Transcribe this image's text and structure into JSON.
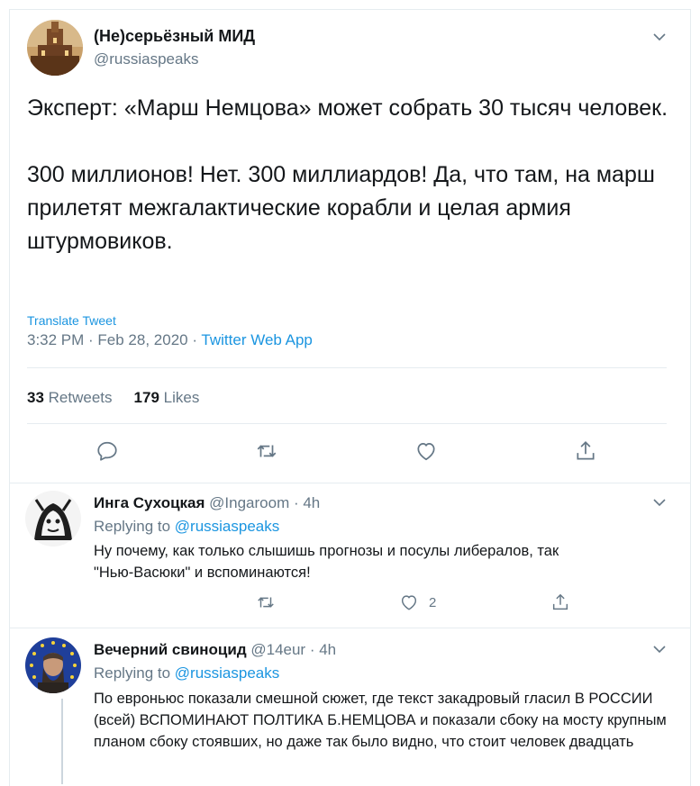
{
  "tweet": {
    "author_name": "(Не)серьёзный МИД",
    "author_handle": "@russiaspeaks",
    "text": "Эксперт: «Марш Немцова» может собрать 30 тысяч человек.\n\n300 миллионов! Нет. 300 миллиардов! Да, что там, на марш прилетят межгалактические корабли и целая армия штурмовиков.",
    "translate_label": "Translate Tweet",
    "time": "3:32 PM · Feb 28, 2020 · ",
    "source": "Twitter Web App",
    "retweets_count": "33",
    "retweets_label": "Retweets",
    "likes_count": "179",
    "likes_label": "Likes"
  },
  "replies": [
    {
      "name": "Инга Сухоцкая",
      "handle_time": "@Ingaroom · 4h",
      "replying_prefix": "Replying to ",
      "replying_to": "@russiaspeaks",
      "text": "Ну почему, как только слышишь прогнозы и посулы либералов, так\n\"Нью-Васюки\" и вспоминаются!",
      "like_count": "2"
    },
    {
      "name": "Вечерний свиноцид",
      "handle_time": "@14eur · 4h",
      "replying_prefix": "Replying to ",
      "replying_to": "@russiaspeaks",
      "text": "По евроньюс показали смешной сюжет, где текст закадровый гласил В РОССИИ (всей) ВСПОМИНАЮТ ПОЛТИКА Б.НЕМЦОВА и показали сбоку на мосту крупным планом сбоку стоявших, но даже так было видно, что стоит человек двадцать"
    }
  ],
  "colors": {
    "accent": "#1b95e0",
    "muted": "#657786",
    "icon": "#657786",
    "border": "#e6ecf0"
  },
  "icons": [
    "chevron-down-icon",
    "reply-icon",
    "retweet-icon",
    "like-icon",
    "share-icon"
  ]
}
